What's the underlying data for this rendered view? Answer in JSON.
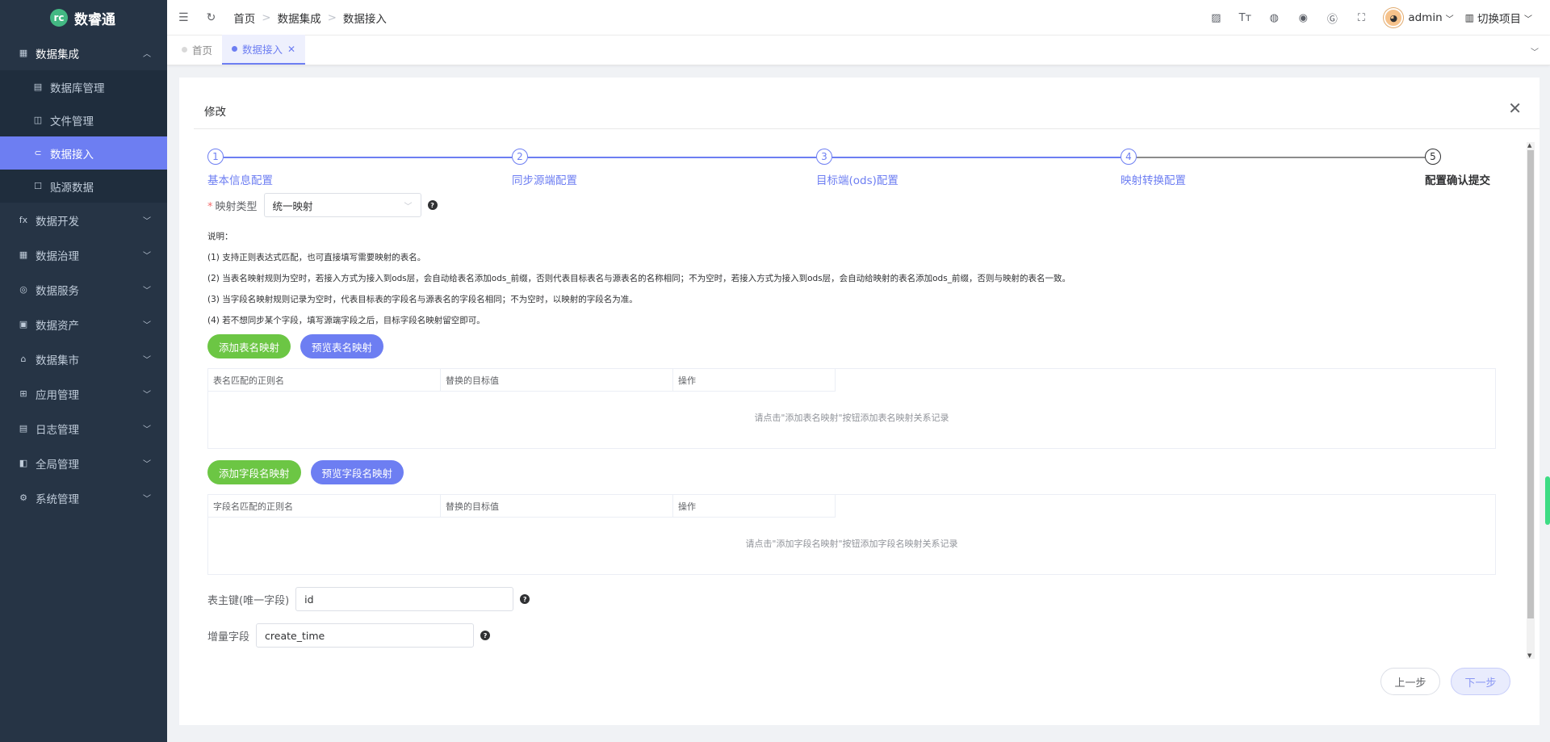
{
  "app": {
    "name": "数睿通"
  },
  "sidebar": {
    "groups": [
      {
        "label": "数据集成",
        "icon": "grid-icon",
        "open": true,
        "items": [
          {
            "label": "数据库管理",
            "icon": "database-icon"
          },
          {
            "label": "文件管理",
            "icon": "file-icon"
          },
          {
            "label": "数据接入",
            "icon": "link-icon",
            "active": true
          },
          {
            "label": "贴源数据",
            "icon": "square-icon"
          }
        ]
      },
      {
        "label": "数据开发",
        "icon": "fx-icon"
      },
      {
        "label": "数据治理",
        "icon": "table-icon"
      },
      {
        "label": "数据服务",
        "icon": "service-icon"
      },
      {
        "label": "数据资产",
        "icon": "asset-icon"
      },
      {
        "label": "数据集市",
        "icon": "market-icon"
      },
      {
        "label": "应用管理",
        "icon": "apps-icon"
      },
      {
        "label": "日志管理",
        "icon": "log-icon"
      },
      {
        "label": "全局管理",
        "icon": "global-icon"
      },
      {
        "label": "系统管理",
        "icon": "settings-icon"
      }
    ]
  },
  "header": {
    "breadcrumb": [
      "首页",
      "数据集成",
      "数据接入"
    ],
    "user": "admin",
    "project": "切换项目"
  },
  "tags": [
    {
      "label": "首页",
      "active": false
    },
    {
      "label": "数据接入",
      "active": true
    }
  ],
  "dialog": {
    "title": "修改",
    "steps": [
      {
        "num": "1",
        "title": "基本信息配置"
      },
      {
        "num": "2",
        "title": "同步源端配置"
      },
      {
        "num": "3",
        "title": "目标端(ods)配置"
      },
      {
        "num": "4",
        "title": "映射转换配置"
      },
      {
        "num": "5",
        "title": "配置确认提交"
      }
    ],
    "mapping_type": {
      "label": "映射类型",
      "value": "统一映射"
    },
    "notes": [
      "说明：",
      "(1) 支持正则表达式匹配，也可直接填写需要映射的表名。",
      "(2) 当表名映射规则为空时，若接入方式为接入到ods层，会自动给表名添加ods_前缀，否则代表目标表名与源表名的名称相同；不为空时，若接入方式为接入到ods层，会自动给映射的表名添加ods_前缀，否则与映射的表名一致。",
      "(3) 当字段名映射规则记录为空时，代表目标表的字段名与源表名的字段名相同；不为空时，以映射的字段名为准。",
      "(4) 若不想同步某个字段，填写源端字段之后，目标字段名映射留空即可。"
    ],
    "table_mapping": {
      "add_label": "添加表名映射",
      "preview_label": "预览表名映射",
      "columns": [
        "表名匹配的正则名",
        "替换的目标值",
        "操作"
      ],
      "empty": "请点击\"添加表名映射\"按钮添加表名映射关系记录"
    },
    "field_mapping": {
      "add_label": "添加字段名映射",
      "preview_label": "预览字段名映射",
      "columns": [
        "字段名匹配的正则名",
        "替换的目标值",
        "操作"
      ],
      "empty": "请点击\"添加字段名映射\"按钮添加字段名映射关系记录"
    },
    "primary_key": {
      "label": "表主键(唯一字段)",
      "value": "id"
    },
    "incremental": {
      "label": "增量字段",
      "value": "create_time"
    },
    "prev_label": "上一步",
    "next_label": "下一步"
  }
}
